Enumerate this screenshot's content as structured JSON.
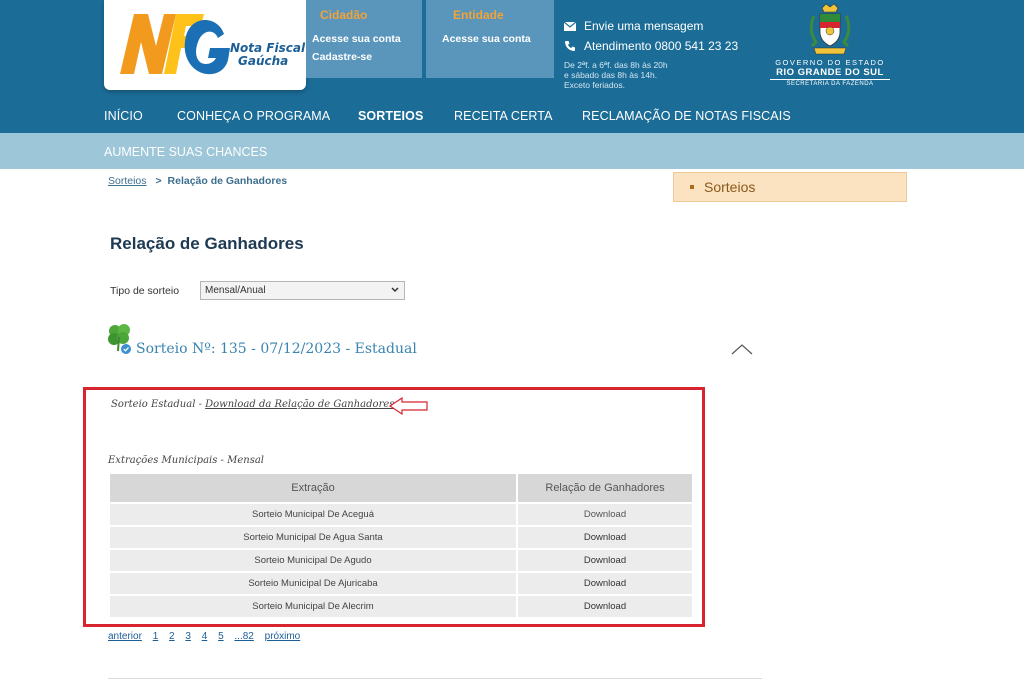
{
  "header": {
    "logo_text_line1": "Nota Fiscal",
    "logo_text_line2": "Gaúcha",
    "cidadao": {
      "title": "Cidadão",
      "link1": "Acesse sua conta",
      "link2": "Cadastre-se"
    },
    "entidade": {
      "title": "Entidade",
      "link1": "Acesse sua conta"
    },
    "contact": {
      "message": "Envie uma mensagem",
      "phone": "Atendimento 0800 541 23 23",
      "hours_line1": "De 2ªf. a 6ªf. das 8h às 20h",
      "hours_line2": "e sábado das 8h às 14h.",
      "hours_line3": "Exceto feriados."
    },
    "gov": {
      "line1": "GOVERNO DO ESTADO",
      "line2": "RIO GRANDE DO SUL",
      "line3": "SECRETARIA DA FAZENDA"
    }
  },
  "nav": {
    "items": [
      "INÍCIO",
      "CONHEÇA O PROGRAMA",
      "SORTEIOS",
      "RECEITA CERTA",
      "RECLAMAÇÃO DE NOTAS FISCAIS"
    ],
    "active": "SORTEIOS",
    "sub_item": "AUMENTE SUAS CHANCES"
  },
  "breadcrumb": {
    "parent": "Sorteios",
    "separator": ">",
    "current": "Relação de Ganhadores"
  },
  "sidebar": {
    "label": "Sorteios"
  },
  "page_title": "Relação de Ganhadores",
  "filter": {
    "label": "Tipo de sorteio",
    "selected": "Mensal/Anual"
  },
  "sorteio": {
    "title": "Sorteio Nº: 135 - 07/12/2023 - Estadual",
    "estadual_prefix": "Sorteio Estadual - ",
    "download_link": "Download da Relação de Ganhadores",
    "municipais_label": "Extrações Municipais - Mensal"
  },
  "table": {
    "headers": [
      "Extração",
      "Relação de Ganhadores"
    ],
    "rows": [
      {
        "extracao": "Sorteio Municipal De Aceguá",
        "link": "Download"
      },
      {
        "extracao": "Sorteio Municipal De Agua Santa",
        "link": "Download"
      },
      {
        "extracao": "Sorteio Municipal De Agudo",
        "link": "Download"
      },
      {
        "extracao": "Sorteio Municipal De Ajuricaba",
        "link": "Download"
      },
      {
        "extracao": "Sorteio Municipal De Alecrim",
        "link": "Download"
      }
    ]
  },
  "pagination": {
    "prev": "anterior",
    "pages": [
      "1",
      "2",
      "3",
      "4",
      "5"
    ],
    "last": "...82",
    "next": "próximo"
  },
  "colors": {
    "header_blue": "#1b6c97",
    "subnav_blue": "#9dc6d8",
    "accent_orange": "#f3a338",
    "annotation_red": "#d8242f"
  },
  "icons": [
    "envelope-icon",
    "phone-icon",
    "state-crest-icon",
    "clover-icon",
    "collapse-chevron-icon",
    "annotation-arrow-icon",
    "dropdown-chevron-icon"
  ]
}
